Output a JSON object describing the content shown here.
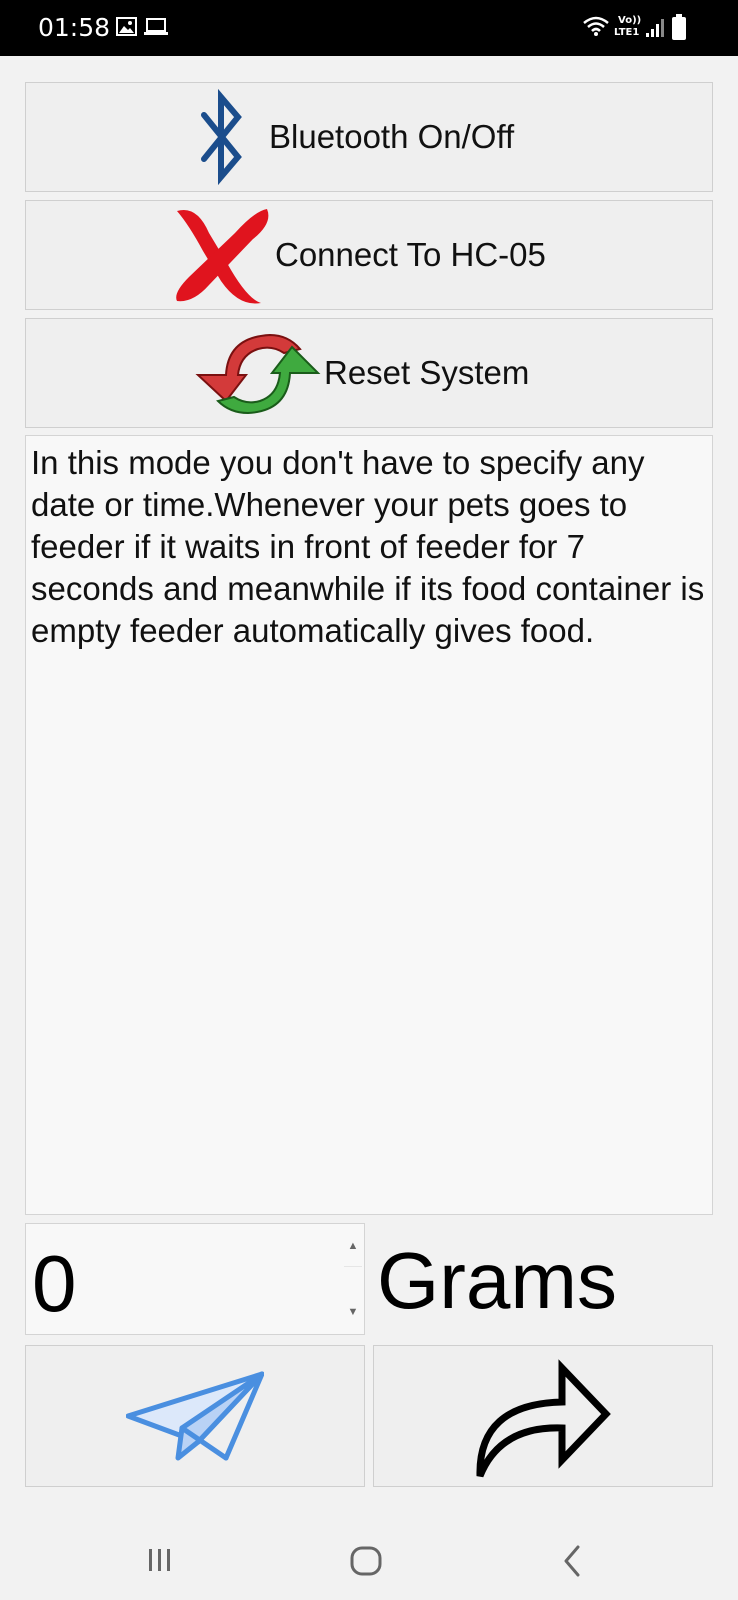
{
  "status_bar": {
    "time": "01:58",
    "icons": [
      "image-icon",
      "laptop-icon",
      "wifi-icon",
      "volte-icon",
      "signal-icon",
      "battery-icon"
    ],
    "network_top": "Vo))",
    "network_bottom": "LTE1"
  },
  "buttons": {
    "bluetooth": {
      "label": "Bluetooth On/Off",
      "icon": "bluetooth-icon",
      "color": "#1b4d8c"
    },
    "connect": {
      "label": "Connect To HC-05",
      "icon": "red-x-icon",
      "color": "#e0141e"
    },
    "reset": {
      "label": "Reset System",
      "icon": "refresh-arrows-icon"
    }
  },
  "description": "In this mode you don't have to specify any date or time.Whenever your pets goes to feeder if it waits in front of feeder for 7 seconds and meanwhile if its food container is empty feeder automatically gives food.",
  "amount": {
    "value": "0",
    "unit": "Grams"
  },
  "actions": {
    "send": {
      "icon": "paper-plane-icon",
      "color": "#4a8fe0"
    },
    "forward": {
      "icon": "share-arrow-icon"
    }
  },
  "nav": {
    "items": [
      "recent-apps-icon",
      "home-icon",
      "back-icon"
    ]
  }
}
